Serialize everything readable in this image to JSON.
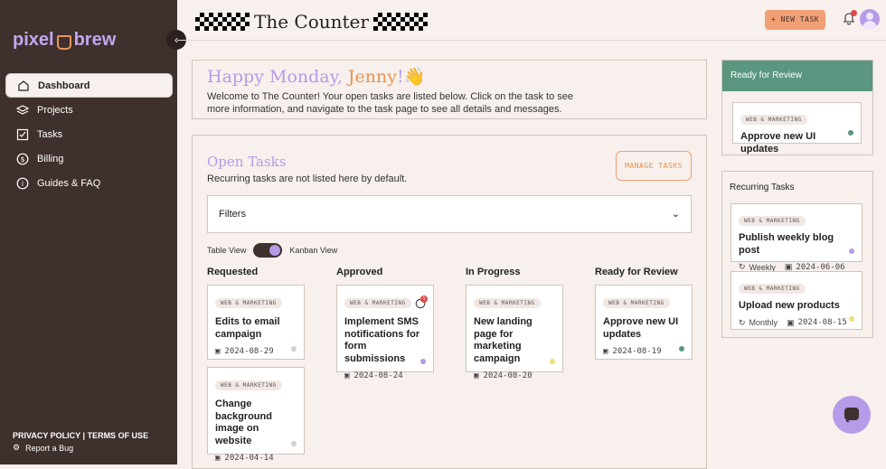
{
  "brand": {
    "logo_left": "pixel",
    "logo_right": "brew"
  },
  "app_title": "The Counter",
  "sidebar": {
    "items": [
      {
        "label": "Dashboard",
        "icon": "home-icon",
        "active": true
      },
      {
        "label": "Projects",
        "icon": "layers-icon"
      },
      {
        "label": "Tasks",
        "icon": "checkbox-icon"
      },
      {
        "label": "Billing",
        "icon": "dollar-icon"
      },
      {
        "label": "Guides & FAQ",
        "icon": "info-icon"
      }
    ],
    "privacy": "PRIVACY POLICY",
    "terms": "TERMS OF USE",
    "report": "Report a Bug"
  },
  "header": {
    "new_task": "+ NEW TASK"
  },
  "welcome": {
    "greeting": "Happy Monday, ",
    "name": "Jenny",
    "emoji": "!👋",
    "text": "Welcome to The Counter! Your open tasks are listed below. Click on the task to see more information, and navigate to the task page to see all details and messages."
  },
  "open_tasks": {
    "title": "Open Tasks",
    "subtitle": "Recurring tasks are not listed here by default.",
    "manage": "MANAGE TASKS",
    "filters": "Filters",
    "table_view": "Table View",
    "kanban_view": "Kanban View"
  },
  "columns": [
    {
      "title": "Requested",
      "cards": [
        {
          "tag": "WEB & MARKETING",
          "title": "Edits to email campaign",
          "date": "2024-08-29",
          "dot": "#d6d0cd"
        },
        {
          "tag": "WEB & MARKETING",
          "title": "Change background image on website",
          "date": "2024-04-14",
          "dot": "#d6d0cd"
        }
      ]
    },
    {
      "title": "Approved",
      "cards": [
        {
          "tag": "WEB & MARKETING",
          "title": "Implement SMS notifications for form submissions",
          "date": "2024-08-24",
          "dot": "#b79ae8",
          "badge": "1"
        }
      ]
    },
    {
      "title": "In Progress",
      "cards": [
        {
          "tag": "WEB & MARKETING",
          "title": "New landing page for marketing campaign",
          "date": "2024-08-20",
          "dot": "#e9e27a"
        }
      ]
    },
    {
      "title": "Ready for Review",
      "cards": [
        {
          "tag": "WEB & MARKETING",
          "title": "Approve new UI updates",
          "date": "2024-08-19",
          "dot": "#5a9680"
        }
      ]
    }
  ],
  "review_panel": {
    "title": "Ready for Review",
    "card": {
      "tag": "WEB & MARKETING",
      "title": "Approve new UI updates",
      "dot": "#5a9680"
    }
  },
  "recurring": {
    "title": "Recurring Tasks",
    "cards": [
      {
        "tag": "WEB & MARKETING",
        "title": "Publish weekly blog post",
        "freq": "Weekly",
        "date": "2024-06-06",
        "dot": "#b79ae8"
      },
      {
        "tag": "WEB & MARKETING",
        "title": "Upload new products",
        "freq": "Monthly",
        "date": "2024-08-15",
        "dot": "#e9e27a"
      }
    ]
  },
  "colors": {
    "accent_purple": "#b79ae8",
    "accent_orange": "#f19f74",
    "sidebar_bg": "#3e302c",
    "review_green": "#5a9680"
  }
}
